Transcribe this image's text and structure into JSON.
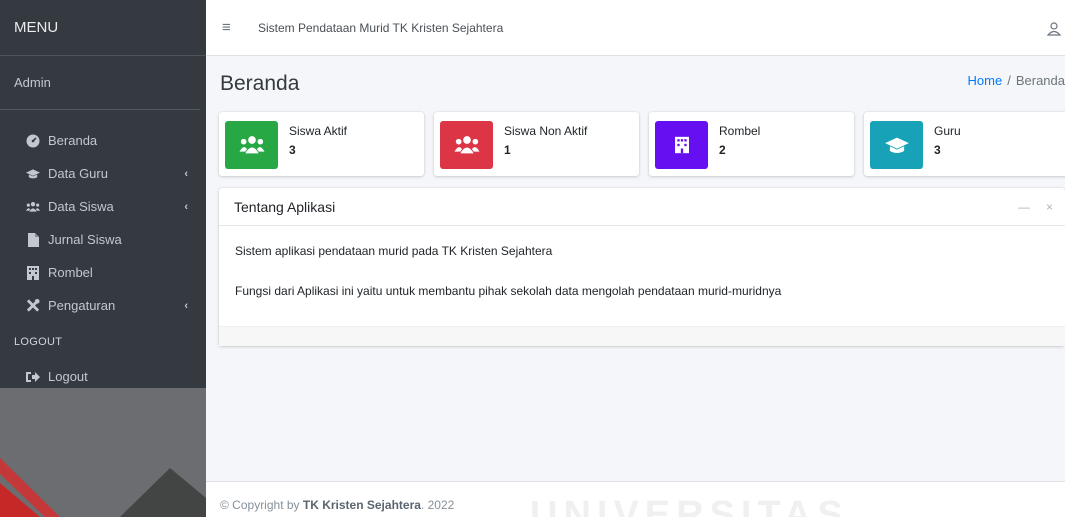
{
  "sidebar": {
    "brand": "MENU",
    "user": "Admin",
    "items": [
      {
        "label": "Beranda",
        "icon": "dashboard-icon",
        "chevron": false
      },
      {
        "label": "Data Guru",
        "icon": "graduation-cap-icon",
        "chevron": true
      },
      {
        "label": "Data Siswa",
        "icon": "users-icon",
        "chevron": true
      },
      {
        "label": "Jurnal Siswa",
        "icon": "file-icon",
        "chevron": false
      },
      {
        "label": "Rombel",
        "icon": "building-icon",
        "chevron": false
      },
      {
        "label": "Pengaturan",
        "icon": "tools-icon",
        "chevron": true
      }
    ],
    "header_logout": "LOGOUT",
    "logout": "Logout",
    "chevron_glyph": "‹"
  },
  "topbar": {
    "title": "Sistem Pendataan Murid TK Kristen Sejahtera",
    "menu_glyph": "≡"
  },
  "page": {
    "title": "Beranda",
    "breadcrumb": {
      "home": "Home",
      "sep": "/",
      "current": "Beranda"
    }
  },
  "stats": [
    {
      "label": "Siswa Aktif",
      "value": "3",
      "color": "#28a745",
      "icon": "users-icon"
    },
    {
      "label": "Siswa Non Aktif",
      "value": "1",
      "color": "#dc3545",
      "icon": "users-icon"
    },
    {
      "label": "Rombel",
      "value": "2",
      "color": "#6610f2",
      "icon": "building-icon"
    },
    {
      "label": "Guru",
      "value": "3",
      "color": "#17a2b8",
      "icon": "graduation-cap-icon"
    }
  ],
  "card": {
    "title": "Tentang Aplikasi",
    "minimize": "—",
    "close": "×",
    "line1": "Sistem aplikasi pendataan murid pada TK Kristen Sejahtera",
    "line2": "Fungsi dari Aplikasi ini yaitu untuk membantu pihak sekolah data mengolah pendataan murid-muridnya"
  },
  "footer": {
    "prefix": "© Copyright by ",
    "brand": "TK Kristen Sejahtera",
    "suffix": ". 2022"
  },
  "watermark": "UNIVERSITAS"
}
